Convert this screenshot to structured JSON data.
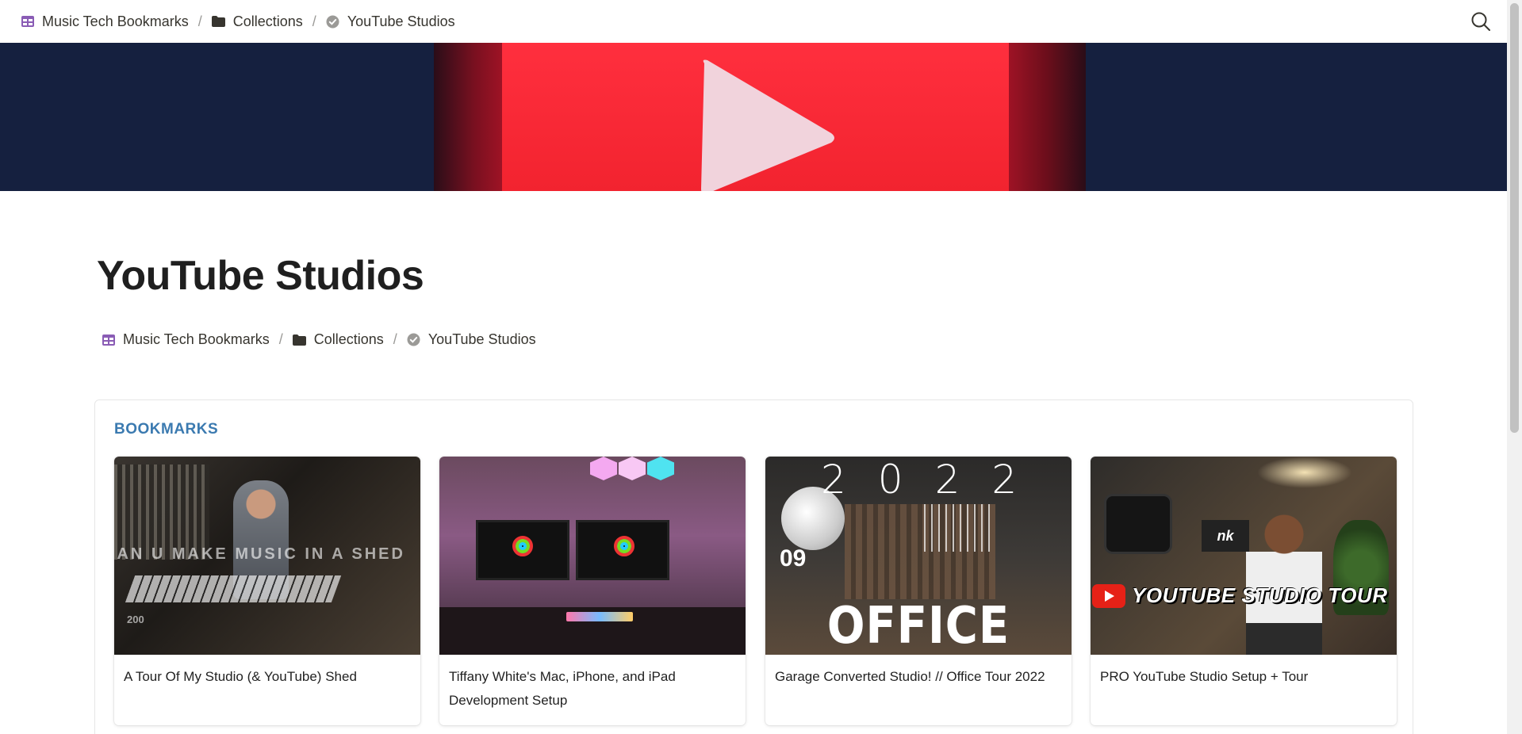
{
  "breadcrumb": {
    "items": [
      {
        "label": "Music Tech Bookmarks",
        "icon": "table-icon"
      },
      {
        "label": "Collections",
        "icon": "folder-icon"
      },
      {
        "label": "YouTube Studios",
        "icon": "verified-badge-icon"
      }
    ],
    "separator": "/"
  },
  "header": {
    "search_icon": "search-icon"
  },
  "page": {
    "title": "YouTube Studios"
  },
  "bookmarks": {
    "heading": "BOOKMARKS",
    "cards": [
      {
        "title": "A Tour Of My Studio (& YouTube) Shed",
        "thumb_text": "CAN U MAKE MUSIC IN A SHED",
        "thumb_number": "200"
      },
      {
        "title": "Tiffany White's Mac, iPhone, and iPad Development Setup"
      },
      {
        "title": "Garage Converted Studio! // Office Tour 2022",
        "thumb_year": "2022",
        "thumb_number": "09",
        "thumb_caption": "OFFICE TOUR"
      },
      {
        "title": "PRO YouTube Studio Setup + Tour",
        "thumb_sign": "nk",
        "thumb_caption": "YOUTUBE STUDIO TOUR"
      }
    ]
  },
  "colors": {
    "accent_heading": "#3b7ab0",
    "banner_bg": "#15203f",
    "banner_red": "#ff2f3e",
    "table_icon": "#8a5cb5"
  }
}
